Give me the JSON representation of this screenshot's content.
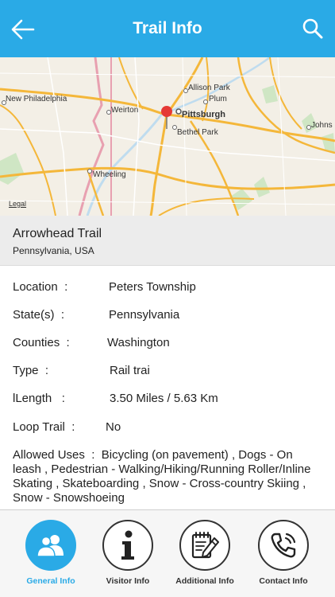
{
  "header": {
    "title": "Trail Info",
    "back_icon": "arrow-left-icon",
    "search_icon": "search-icon",
    "background": "#2aaae6"
  },
  "map": {
    "labels": {
      "new_philadelphia": "New Philadelphia",
      "weirton": "Weirton",
      "pittsburgh": "Pittsburgh",
      "allison_park": "Allison Park",
      "plum": "Plum",
      "bethel_park": "Bethel Park",
      "johnstown": "Johns",
      "wheeling": "Wheeling"
    },
    "legal": "Legal",
    "pin_color": "#e53935"
  },
  "trail": {
    "name": "Arrowhead Trail",
    "region": "Pennsylvania, USA"
  },
  "details": {
    "location_label": "Location",
    "location_value": "Peters Township",
    "states_label": "State(s)",
    "states_value": "Pennsylvania",
    "counties_label": "Counties",
    "counties_value": "Washington",
    "type_label": "Type",
    "type_value": "Rail trai",
    "length_label": "lLength",
    "length_value": "3.50 Miles / 5.63 Km",
    "loop_label": "Loop Trail",
    "loop_value": "No",
    "colon": ":",
    "uses_label": "Allowed Uses",
    "uses_value": "Bicycling (on pavement) , Dogs - On leash , Pedestrian - Walking/Hiking/Running Roller/Inline Skating , Skateboarding , Snow - Cross-country Skiing , Snow - Snowshoeing"
  },
  "tabs": [
    {
      "label": "General Info",
      "icon": "users-icon",
      "active": true
    },
    {
      "label": "Visitor Info",
      "icon": "info-icon",
      "active": false
    },
    {
      "label": "Additional Info",
      "icon": "notepad-pencil-icon",
      "active": false
    },
    {
      "label": "Contact Info",
      "icon": "phone-icon",
      "active": false
    }
  ]
}
